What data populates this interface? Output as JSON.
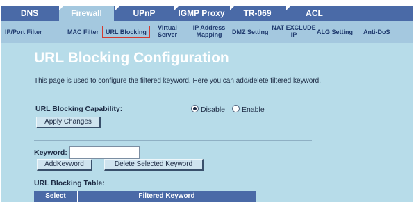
{
  "top_tabs": [
    {
      "label": "DNS",
      "active": false
    },
    {
      "label": "Firewall",
      "active": true
    },
    {
      "label": "UPnP",
      "active": false
    },
    {
      "label": "IGMP Proxy",
      "active": false
    },
    {
      "label": "TR-069",
      "active": false
    },
    {
      "label": "ACL",
      "active": false
    }
  ],
  "sub_tabs": [
    {
      "label": "IP/Port Filter",
      "active": false
    },
    {
      "label": "MAC Filter",
      "active": false
    },
    {
      "label": "URL Blocking",
      "active": true
    },
    {
      "line1": "Virtual",
      "line2": "Server",
      "active": false
    },
    {
      "line1": "IP Address",
      "line2": "Mapping",
      "active": false
    },
    {
      "label": "DMZ Setting",
      "active": false
    },
    {
      "line1": "NAT EXCLUDE",
      "line2": "IP",
      "active": false
    },
    {
      "label": "ALG Setting",
      "active": false
    },
    {
      "label": "Anti-DoS",
      "active": false
    }
  ],
  "page": {
    "title": "URL Blocking Configuration",
    "description": "This page is used to configure the filtered keyword. Here you can add/delete filtered keyword."
  },
  "capability": {
    "label": "URL Blocking Capability:",
    "options": [
      {
        "label": "Disable",
        "selected": true
      },
      {
        "label": "Enable",
        "selected": false
      }
    ],
    "apply_label": "Apply Changes"
  },
  "keyword": {
    "label": "Keyword:",
    "value": "",
    "add_label": "AddKeyword",
    "delete_label": "Delete Selected Keyword"
  },
  "table": {
    "title": "URL Blocking Table:",
    "columns": [
      "Select",
      "Filtered Keyword"
    ]
  },
  "colors": {
    "background": "#b7dce9",
    "nav": "#4a6aa7",
    "subnav": "#a4c8df",
    "active_outline": "#d33a2f"
  }
}
